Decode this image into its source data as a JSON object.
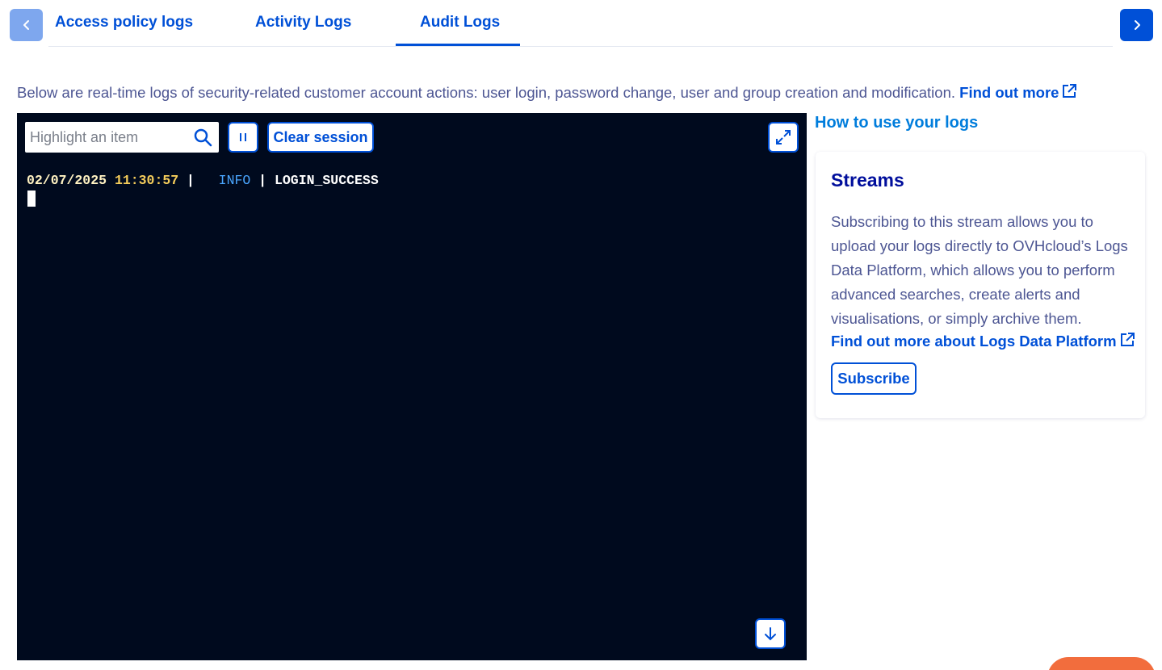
{
  "tabs": {
    "items": [
      {
        "label": "Access policy logs"
      },
      {
        "label": "Activity Logs"
      },
      {
        "label": "Audit Logs",
        "active": true
      }
    ],
    "prev_icon": "chevron-left-icon",
    "next_icon": "chevron-right-icon"
  },
  "intro": {
    "text": "Below are real-time logs of security-related customer account actions: user login, password change, user and group creation and modification.",
    "link_label": "Find out more",
    "link_icon": "external-link-icon"
  },
  "terminal": {
    "search_placeholder": "Highlight an item",
    "search_value": "",
    "pause_icon": "pause-icon",
    "clear_label": "Clear session",
    "expand_icon": "expand-icon",
    "scroll_icon": "arrow-down-icon",
    "log": {
      "date": "02/07/2025",
      "time": "11:30:57",
      "sep1": " |   ",
      "level": "INFO",
      "sep2": " | ",
      "message": "LOGIN_SUCCESS"
    }
  },
  "side": {
    "howto_label": "How to use your logs",
    "card": {
      "title": "Streams",
      "description": "Subscribing to this stream allows you to upload your logs directly to OVHcloud’s Logs Data Platform, which allows you to perform advanced searches, create alerts and visualisations, or simply archive them.",
      "link_label": "Find out more about Logs Data Platform",
      "subscribe_label": "Subscribe"
    }
  },
  "colors": {
    "primary": "#0050d7",
    "terminal_bg": "#000a1e",
    "title": "#000e9c",
    "text": "#4d5693",
    "fab": "#f26d3d"
  }
}
